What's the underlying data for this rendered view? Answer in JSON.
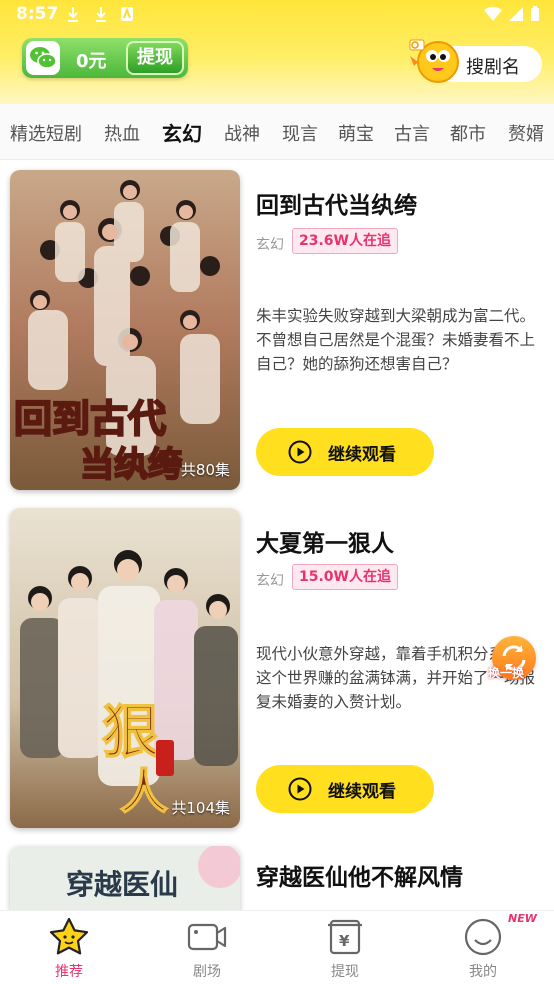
{
  "status_bar": {
    "time": "8:57"
  },
  "header": {
    "wallet_amount": "0元",
    "withdraw_label": "提现",
    "search_label": "搜剧名"
  },
  "tabs": [
    {
      "label": "精选短剧",
      "active": false
    },
    {
      "label": "热血",
      "active": false
    },
    {
      "label": "玄幻",
      "active": true
    },
    {
      "label": "战神",
      "active": false
    },
    {
      "label": "现言",
      "active": false
    },
    {
      "label": "萌宝",
      "active": false
    },
    {
      "label": "古言",
      "active": false
    },
    {
      "label": "都市",
      "active": false
    },
    {
      "label": "赘婿",
      "active": false
    }
  ],
  "dramas": [
    {
      "title": "回到古代当纨绔",
      "genre": "玄幻",
      "chase": "23.6W人在追",
      "description": "朱丰实验失败穿越到大梁朝成为富二代。不曾想自己居然是个混蛋？未婚妻看不上自己？她的舔狗还想害自己？",
      "episodes": "共80集",
      "poster_text": "回到古代当纨绔",
      "watch_label": "继续观看"
    },
    {
      "title": "大夏第一狠人",
      "genre": "玄幻",
      "chase": "15.0W人在追",
      "description": "现代小伙意外穿越，靠着手机积分系统在这个世界赚的盆满钵满，并开始了一场报复未婚妻的入赘计划。",
      "episodes": "共104集",
      "poster_text": "狠人",
      "watch_label": "继续观看"
    },
    {
      "title": "穿越医仙他不解风情",
      "poster_text": "穿越医仙"
    }
  ],
  "float_button": {
    "label": "换一换"
  },
  "bottom_nav": [
    {
      "label": "推荐",
      "icon": "star-face-icon",
      "active": true
    },
    {
      "label": "剧场",
      "icon": "video-camera-icon",
      "active": false
    },
    {
      "label": "提现",
      "icon": "yuan-wallet-icon",
      "active": false
    },
    {
      "label": "我的",
      "icon": "smile-face-icon",
      "active": false
    }
  ],
  "new_badge": "NEW",
  "colors": {
    "header_yellow": "#ffe53a",
    "button_yellow": "#ffdf1e",
    "accent_pink": "#e8336d",
    "wallet_green": "#4bb83a"
  }
}
